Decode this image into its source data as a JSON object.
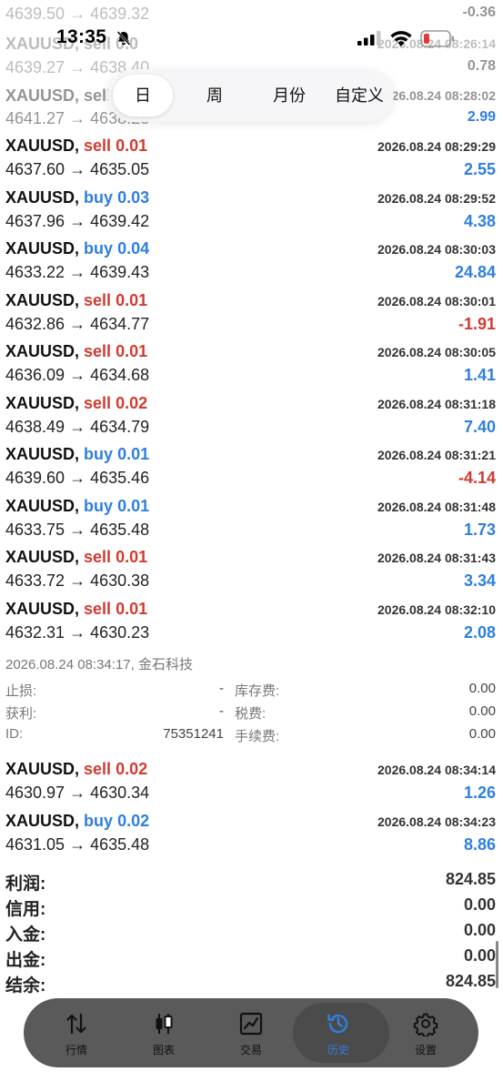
{
  "status_bar": {
    "time": "13:35",
    "icons": [
      "bell-slash-icon",
      "signal-icon",
      "wifi-icon",
      "battery-low-icon"
    ]
  },
  "colors": {
    "buy": "#2f7fe0",
    "sell": "#d43a2f",
    "profit_pos": "#2f7fe0",
    "profit_neg": "#d43a2f",
    "tab_active": "#2f7fe0"
  },
  "faded_rows": [
    {
      "text": "4639.50 → 4639.32",
      "value": "-0.36",
      "value_color": "#d43a2f"
    },
    {
      "text": "XAUUSD, sell 0.0",
      "value": "2026.08.24 08:26:14",
      "value_color": "#333333"
    },
    {
      "text": "4639.27 → 4638.40",
      "value": "0.78",
      "value_color": "#2f7fe0"
    },
    {
      "text": "XAUUSD, sell 0",
      "value": "2026.08.24 08:28:02",
      "value_color": "#333333"
    },
    {
      "text": "4641.27 → 4638.28",
      "value": "2.99",
      "value_color": "#2f7fe0"
    }
  ],
  "period_tabs": [
    {
      "label": "日",
      "active": true
    },
    {
      "label": "周",
      "active": false
    },
    {
      "label": "月份",
      "active": false
    },
    {
      "label": "自定义",
      "active": false
    }
  ],
  "trades": [
    {
      "symbol": "XAUUSD,",
      "side": "sell",
      "lots": "0.01",
      "time": "2026.08.24 08:29:29",
      "open": "4637.60",
      "close": "4635.05",
      "profit": "2.55",
      "negative": false
    },
    {
      "symbol": "XAUUSD,",
      "side": "buy",
      "lots": "0.03",
      "time": "2026.08.24 08:29:52",
      "open": "4637.96",
      "close": "4639.42",
      "profit": "4.38",
      "negative": false
    },
    {
      "symbol": "XAUUSD,",
      "side": "buy",
      "lots": "0.04",
      "time": "2026.08.24 08:30:03",
      "open": "4633.22",
      "close": "4639.43",
      "profit": "24.84",
      "negative": false
    },
    {
      "symbol": "XAUUSD,",
      "side": "sell",
      "lots": "0.01",
      "time": "2026.08.24 08:30:01",
      "open": "4632.86",
      "close": "4634.77",
      "profit": "-1.91",
      "negative": true
    },
    {
      "symbol": "XAUUSD,",
      "side": "sell",
      "lots": "0.01",
      "time": "2026.08.24 08:30:05",
      "open": "4636.09",
      "close": "4634.68",
      "profit": "1.41",
      "negative": false
    },
    {
      "symbol": "XAUUSD,",
      "side": "sell",
      "lots": "0.02",
      "time": "2026.08.24 08:31:18",
      "open": "4638.49",
      "close": "4634.79",
      "profit": "7.40",
      "negative": false
    },
    {
      "symbol": "XAUUSD,",
      "side": "buy",
      "lots": "0.01",
      "time": "2026.08.24 08:31:21",
      "open": "4639.60",
      "close": "4635.46",
      "profit": "-4.14",
      "negative": true
    },
    {
      "symbol": "XAUUSD,",
      "side": "buy",
      "lots": "0.01",
      "time": "2026.08.24 08:31:48",
      "open": "4633.75",
      "close": "4635.48",
      "profit": "1.73",
      "negative": false
    },
    {
      "symbol": "XAUUSD,",
      "side": "sell",
      "lots": "0.01",
      "time": "2026.08.24 08:31:43",
      "open": "4633.72",
      "close": "4630.38",
      "profit": "3.34",
      "negative": false
    },
    {
      "symbol": "XAUUSD,",
      "side": "sell",
      "lots": "0.01",
      "time": "2026.08.24 08:32:10",
      "open": "4632.31",
      "close": "4630.23",
      "profit": "2.08",
      "negative": false
    }
  ],
  "detail": {
    "header": "2026.08.24 08:34:17, 金石科技",
    "rows": [
      {
        "k1": "止损:",
        "v1": "-",
        "k2": "库存费:",
        "v2": "0.00"
      },
      {
        "k1": "获利:",
        "v1": "-",
        "k2": "税费:",
        "v2": "0.00"
      },
      {
        "k1": "ID:",
        "v1": "75351241",
        "k2": "手续费:",
        "v2": "0.00"
      }
    ]
  },
  "trades_after": [
    {
      "symbol": "XAUUSD,",
      "side": "sell",
      "lots": "0.02",
      "time": "2026.08.24 08:34:14",
      "open": "4630.97",
      "close": "4630.34",
      "profit": "1.26",
      "negative": false
    },
    {
      "symbol": "XAUUSD,",
      "side": "buy",
      "lots": "0.02",
      "time": "2026.08.24 08:34:23",
      "open": "4631.05",
      "close": "4635.48",
      "profit": "8.86",
      "negative": false
    }
  ],
  "summary": [
    {
      "label": "利润:",
      "value": "824.85"
    },
    {
      "label": "信用:",
      "value": "0.00"
    },
    {
      "label": "入金:",
      "value": "0.00"
    },
    {
      "label": "出金:",
      "value": "0.00"
    },
    {
      "label": "结余:",
      "value": "824.85"
    }
  ],
  "tab_bar": [
    {
      "label": "行情",
      "icon": "quotes-arrows-icon",
      "active": false
    },
    {
      "label": "图表",
      "icon": "candlestick-chart-icon",
      "active": false
    },
    {
      "label": "交易",
      "icon": "trade-chart-icon",
      "active": false
    },
    {
      "label": "历史",
      "icon": "history-clock-icon",
      "active": true
    },
    {
      "label": "设置",
      "icon": "settings-gear-icon",
      "active": false
    }
  ]
}
